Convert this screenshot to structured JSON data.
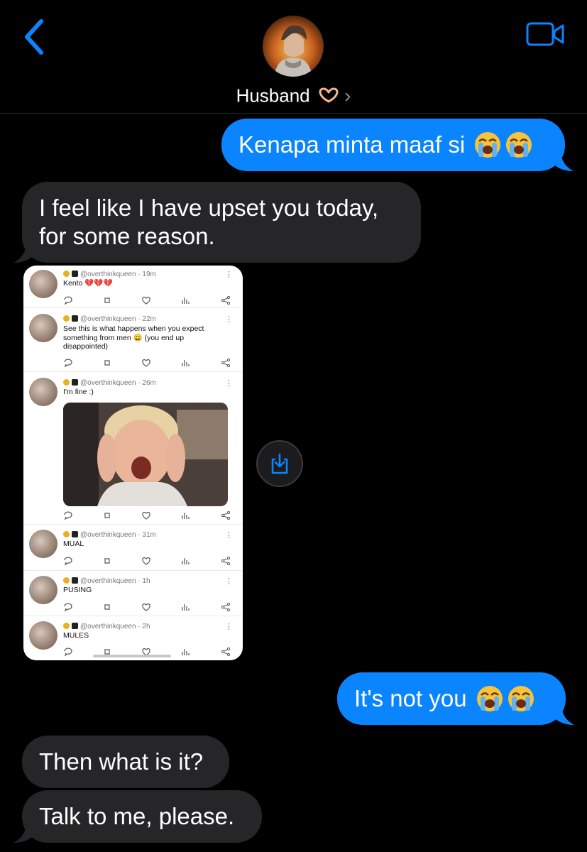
{
  "header": {
    "back_icon": "chevron-left-icon",
    "video_icon": "video-camera-icon",
    "contact_name": "Husband",
    "contact_emoji": "heart-hands-icon",
    "chevron": "›"
  },
  "messages": [
    {
      "direction": "sent",
      "text": "Kenapa minta maaf si",
      "emoji": [
        "loudly-crying-face",
        "loudly-crying-face"
      ]
    },
    {
      "direction": "received",
      "line1": "I feel like I have upset you today,",
      "line2": "for some reason."
    },
    {
      "direction": "received",
      "type": "image"
    },
    {
      "direction": "sent",
      "text": "It's not you",
      "emoji": [
        "loudly-crying-face",
        "loudly-crying-face"
      ]
    },
    {
      "direction": "received",
      "text": "Then what is it?"
    },
    {
      "direction": "received",
      "text": "Talk to me, please."
    }
  ],
  "screenshot_tweets": [
    {
      "handle": "@overthinkqueen",
      "time": "· 19m",
      "text": "Kento 💔💔💔"
    },
    {
      "handle": "@overthinkqueen",
      "time": "· 22m",
      "text": "See this is what happens when you expect something from men 😀 (you end up disappointed)"
    },
    {
      "handle": "@overthinkqueen",
      "time": "· 26m",
      "text": "I'm fine :)"
    },
    {
      "handle": "@overthinkqueen",
      "time": "· 31m",
      "text": "MUAL"
    },
    {
      "handle": "@overthinkqueen",
      "time": "· 1h",
      "text": "PUSING"
    },
    {
      "handle": "@overthinkqueen",
      "time": "· 2h",
      "text": "MULES"
    }
  ],
  "colors": {
    "sent_bubble": "#0a84ff",
    "received_bubble": "#262628",
    "accent": "#0a84ff",
    "background": "#000000"
  }
}
